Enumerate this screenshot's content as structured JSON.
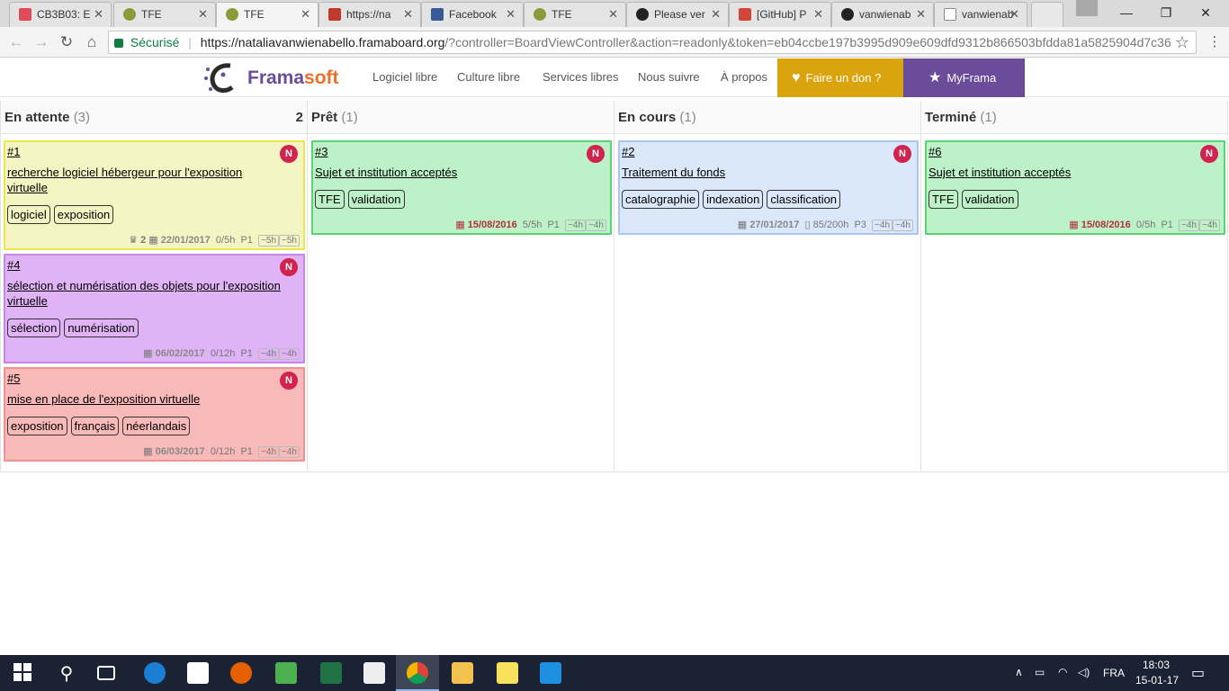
{
  "browser": {
    "tabs": [
      {
        "label": "CB3B03: E",
        "color": "#e04b5a"
      },
      {
        "label": "TFE",
        "color": "#8a9c3a"
      },
      {
        "label": "TFE",
        "color": "#8a9c3a"
      },
      {
        "label": "https://na",
        "color": "#c0392b"
      },
      {
        "label": "Facebook",
        "color": "#3b5998"
      },
      {
        "label": "TFE",
        "color": "#8a9c3a"
      },
      {
        "label": "Please ver",
        "color": "#222222"
      },
      {
        "label": "[GitHub] P",
        "color": "#d44638"
      },
      {
        "label": "vanwienab",
        "color": "#222222"
      },
      {
        "label": "vanwienab",
        "color": "#888888"
      }
    ],
    "security_label": "Sécurisé",
    "url_host": "https://nataliavanwienabello.framaboard.org",
    "url_rest": "/?controller=BoardViewController&action=readonly&token=eb04ccbe197b3995d909e609dfd9312b866503bfdda81a5825904d7c36"
  },
  "framanav": {
    "brand_frama": "Frama",
    "brand_soft": "soft",
    "links": [
      "Logiciel libre",
      "Culture libre",
      "Services libres",
      "Nous suivre",
      "À propos"
    ],
    "donate_label": "Faire un don ?",
    "myframa_label": "MyFrama"
  },
  "board": {
    "columns": [
      {
        "title": "En attente",
        "count": "(3)",
        "limit": "2"
      },
      {
        "title": "Prêt",
        "count": "(1)"
      },
      {
        "title": "En cours",
        "count": "(1)"
      },
      {
        "title": "Terminé",
        "count": "(1)"
      }
    ],
    "cards": [
      {
        "id": "#1",
        "title": "recherche logiciel hébergeur pour l'exposition virtuelle",
        "tags": [
          "logiciel",
          "exposition"
        ],
        "subtasks": "2",
        "date": "22/01/2017",
        "time": "0/5h",
        "priority": "P1",
        "est1": "~5h",
        "est2": "~5h",
        "avatar": "N",
        "bg": "#f5f5c4",
        "border": "#e8e84a"
      },
      {
        "id": "#4",
        "title": "sélection et numérisation des objets pour l'exposition virtuelle",
        "tags": [
          "sélection",
          "numérisation"
        ],
        "date": "06/02/2017",
        "time": "0/12h",
        "priority": "P1",
        "est1": "~4h",
        "est2": "~4h",
        "avatar": "N",
        "bg": "#dfb3f5",
        "border": "#c388e8"
      },
      {
        "id": "#5",
        "title": "mise en place de l'exposition virtuelle",
        "tags": [
          "exposition",
          "français",
          "néerlandais"
        ],
        "date": "06/03/2017",
        "time": "0/12h",
        "priority": "P1",
        "est1": "~4h",
        "est2": "~4h",
        "avatar": "N",
        "bg": "#f8b9b9",
        "border": "#f09292"
      },
      {
        "id": "#3",
        "title": "Sujet et institution acceptés",
        "tags": [
          "TFE",
          "validation"
        ],
        "date": "15/08/2016",
        "time": "5/5h",
        "priority": "P1",
        "est1": "~4h",
        "est2": "~4h",
        "avatar": "N",
        "bg": "#bdf2c9",
        "border": "#5bd375"
      },
      {
        "id": "#2",
        "title": "Traitement du fonds",
        "tags": [
          "catalographie",
          "indexation",
          "classification"
        ],
        "date": "27/01/2017",
        "time": "85/200h",
        "priority": "P3",
        "est1": "~4h",
        "est2": "~4h",
        "avatar": "N",
        "bg": "#dbe8fb",
        "border": "#a8c6f1"
      },
      {
        "id": "#6",
        "title": "Sujet et institution acceptés",
        "tags": [
          "TFE",
          "validation"
        ],
        "date": "15/08/2016",
        "time": "0/5h",
        "priority": "P1",
        "est1": "~4h",
        "est2": "~4h",
        "avatar": "N",
        "bg": "#bdf2c9",
        "border": "#5bd375"
      }
    ]
  },
  "taskbar": {
    "lang": "FRA",
    "time": "18:03",
    "date": "15-01-17"
  }
}
